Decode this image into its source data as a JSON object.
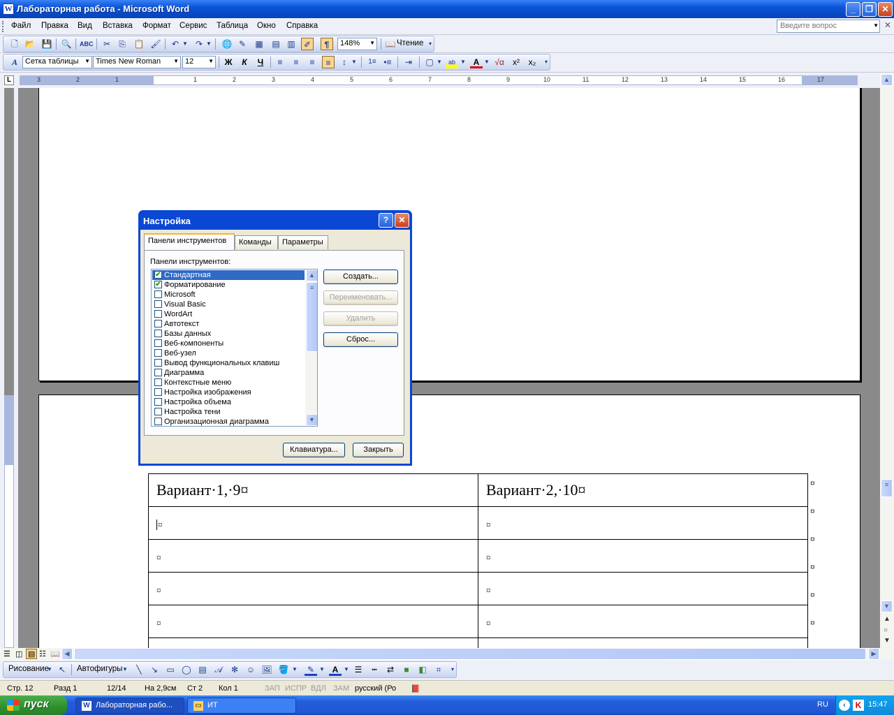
{
  "window": {
    "title": "Лабораторная работа - Microsoft Word",
    "app_icon": "W"
  },
  "menu": {
    "items": [
      "Файл",
      "Правка",
      "Вид",
      "Вставка",
      "Формат",
      "Сервис",
      "Таблица",
      "Окно",
      "Справка"
    ],
    "ask_placeholder": "Введите вопрос"
  },
  "standard_toolbar": {
    "zoom": "148%",
    "reading_label": "Чтение"
  },
  "formatting_toolbar": {
    "style": "Сетка таблицы",
    "font": "Times New Roman",
    "size": "12"
  },
  "ruler": {
    "numbers": [
      "3",
      "2",
      "1",
      "1",
      "2",
      "3",
      "4",
      "5",
      "6",
      "7",
      "8",
      "9",
      "10",
      "11",
      "12",
      "13",
      "14",
      "15",
      "16",
      "17"
    ]
  },
  "document": {
    "table_header": [
      "Вариант·1,·9¤",
      "Вариант·2,·10¤"
    ],
    "cell_mark": "¤",
    "row_mark": "¤"
  },
  "drawing_toolbar": {
    "draw_label": "Рисование",
    "autoshapes_label": "Автофигуры"
  },
  "status": {
    "page": "Стр. 12",
    "section": "Разд 1",
    "pages": "12/14",
    "at": "На 2,9см",
    "line": "Ст 2",
    "col": "Кол 1",
    "rec": "ЗАП",
    "trk": "ИСПР",
    "ext": "ВДЛ",
    "ovr": "ЗАМ",
    "lang": "русский (Ро"
  },
  "taskbar": {
    "start": "пуск",
    "tasks": [
      "Лабораторная рабо...",
      "ИТ"
    ],
    "lang": "RU",
    "time": "15:47"
  },
  "dialog": {
    "title": "Настройка",
    "tabs": [
      "Панели инструментов",
      "Команды",
      "Параметры"
    ],
    "list_label": "Панели инструментов:",
    "toolbars": [
      {
        "name": "Стандартная",
        "checked": true
      },
      {
        "name": "Форматирование",
        "checked": true
      },
      {
        "name": "Microsoft",
        "checked": false
      },
      {
        "name": "Visual Basic",
        "checked": false
      },
      {
        "name": "WordArt",
        "checked": false
      },
      {
        "name": "Автотекст",
        "checked": false
      },
      {
        "name": "Базы данных",
        "checked": false
      },
      {
        "name": "Веб-компоненты",
        "checked": false
      },
      {
        "name": "Веб-узел",
        "checked": false
      },
      {
        "name": "Вывод функциональных клавиш",
        "checked": false
      },
      {
        "name": "Диаграмма",
        "checked": false
      },
      {
        "name": "Контекстные меню",
        "checked": false
      },
      {
        "name": "Настройка изображения",
        "checked": false
      },
      {
        "name": "Настройка объема",
        "checked": false
      },
      {
        "name": "Настройка тени",
        "checked": false
      },
      {
        "name": "Организационная диаграмма",
        "checked": false
      }
    ],
    "buttons": {
      "create": "Создать...",
      "rename": "Переименовать...",
      "delete": "Удалить",
      "reset": "Сброс...",
      "keyboard": "Клавиатура...",
      "close": "Закрыть"
    }
  }
}
